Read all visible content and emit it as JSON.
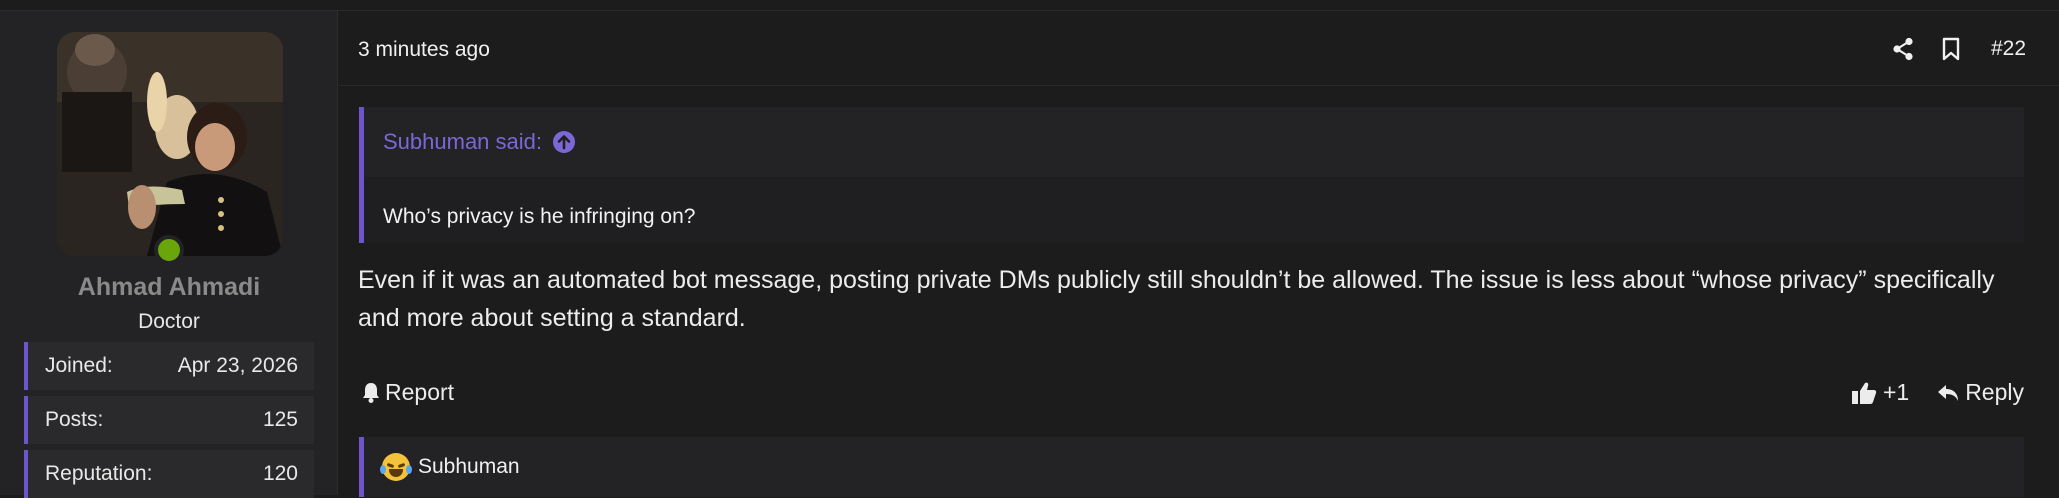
{
  "user": {
    "name": "Ahmad Ahmadi",
    "title": "Doctor",
    "stats": [
      {
        "label": "Joined:",
        "value": "Apr 23, 2026"
      },
      {
        "label": "Posts:",
        "value": "125"
      },
      {
        "label": "Reputation:",
        "value": "120"
      }
    ]
  },
  "post": {
    "time": "3 minutes ago",
    "number": "#22",
    "quote": {
      "author_said": "Subhuman said:",
      "text": "Who’s privacy is he infringing on?"
    },
    "body": "Even if it was an automated bot message, posting private DMs publicly still shouldn’t be allowed. The issue is less about “whose privacy” specifically and more about setting a standard.",
    "report_label": "Report",
    "like_count": "+1",
    "reply_label": "Reply",
    "reaction_user": "Subhuman"
  },
  "colors": {
    "accent": "#6c56c9",
    "quote_link": "#7b67d6",
    "online": "#6aa50a",
    "background": "#1c1c1d"
  }
}
